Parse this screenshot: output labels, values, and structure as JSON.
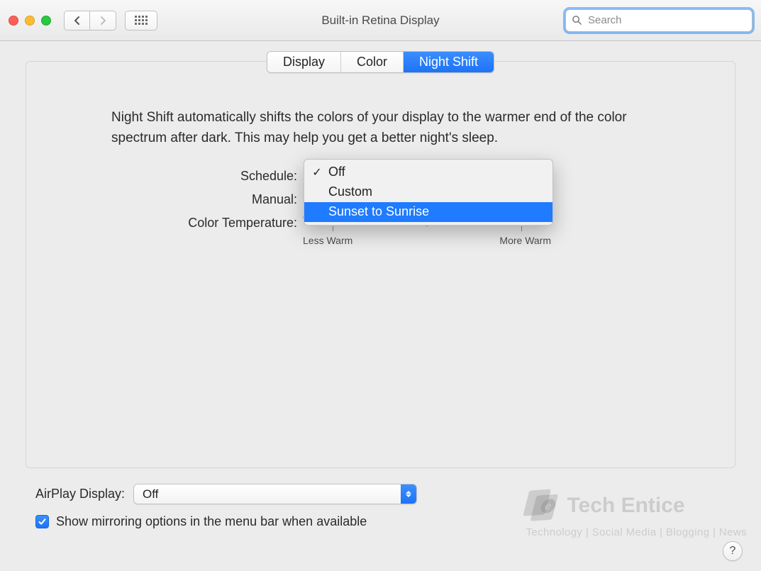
{
  "toolbar": {
    "title": "Built-in Retina Display",
    "search_placeholder": "Search"
  },
  "tabs": {
    "items": [
      "Display",
      "Color",
      "Night Shift"
    ],
    "active_index": 2
  },
  "description": "Night Shift automatically shifts the colors of your display to the warmer end of the color spectrum after dark. This may help you get a better night's sleep.",
  "form": {
    "schedule_label": "Schedule:",
    "manual_label": "Manual:",
    "temperature_label": "Color Temperature:",
    "less_warm": "Less Warm",
    "more_warm": "More Warm"
  },
  "schedule_menu": {
    "items": [
      "Off",
      "Custom",
      "Sunset to Sunrise"
    ],
    "checked_index": 0,
    "highlighted_index": 2
  },
  "airplay": {
    "label": "AirPlay Display:",
    "value": "Off"
  },
  "mirroring": {
    "checked": true,
    "label": "Show mirroring options in the menu bar when available"
  },
  "help_glyph": "?",
  "watermark": {
    "brand": "Tech Entice",
    "tag": "Technology | Social Media | Blogging | News",
    "e": "e"
  }
}
